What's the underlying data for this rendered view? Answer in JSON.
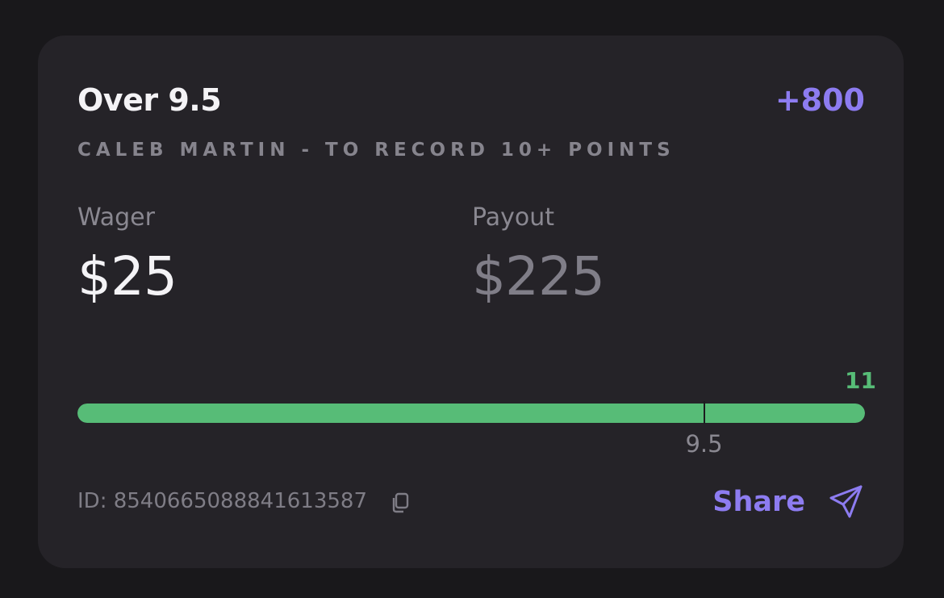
{
  "bet": {
    "title": "Over 9.5",
    "odds": "+800",
    "market": "CALEB MARTIN - TO RECORD 10+ POINTS"
  },
  "wager": {
    "label": "Wager",
    "value": "$25"
  },
  "payout": {
    "label": "Payout",
    "value": "$225"
  },
  "progress": {
    "current": 11,
    "current_label": "11",
    "line": 9.5,
    "line_label": "9.5",
    "max": 11.94,
    "fill_fraction": 1.0,
    "fill_color": "#57bc77"
  },
  "footer": {
    "id_text": "ID: 8540665088841613587",
    "copy_icon": "copy-icon",
    "share_label": "Share",
    "share_icon": "send-icon"
  },
  "colors": {
    "accent": "#8d7cf1",
    "success": "#57bc77",
    "card_bg": "#252328",
    "page_bg": "#19181b"
  }
}
